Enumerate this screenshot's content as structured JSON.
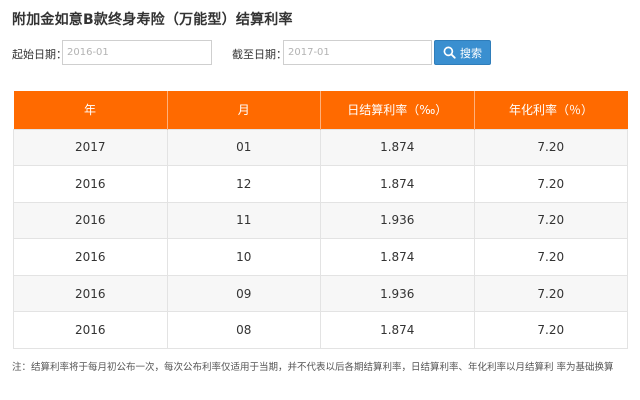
{
  "page": {
    "title": "附加金如意B款终身寿险（万能型）结算利率"
  },
  "filters": {
    "start_label": "起始日期：",
    "start_value": "2016-01",
    "end_label": "截至日期：",
    "end_value": "2017-01",
    "search_label": "搜索",
    "search_icon": "search-icon"
  },
  "table": {
    "headers": [
      "年",
      "月",
      "日结算利率（‰）",
      "年化利率（％）"
    ],
    "rows": [
      [
        "2017",
        "01",
        "1.874",
        "7.20"
      ],
      [
        "2016",
        "12",
        "1.874",
        "7.20"
      ],
      [
        "2016",
        "11",
        "1.936",
        "7.20"
      ],
      [
        "2016",
        "10",
        "1.874",
        "7.20"
      ],
      [
        "2016",
        "09",
        "1.936",
        "7.20"
      ],
      [
        "2016",
        "08",
        "1.874",
        "7.20"
      ]
    ]
  },
  "note": "注：结算利率将于每月初公布一次，每次公布利率仅适用于当期，并不代表以后各期结算利率，日结算利率、年化利率以月结算利 率为基础换算",
  "colors": {
    "header_bg": "#ff6a00",
    "button_bg": "#3a8fd0",
    "row_alt_bg": "#f7f7f7"
  }
}
